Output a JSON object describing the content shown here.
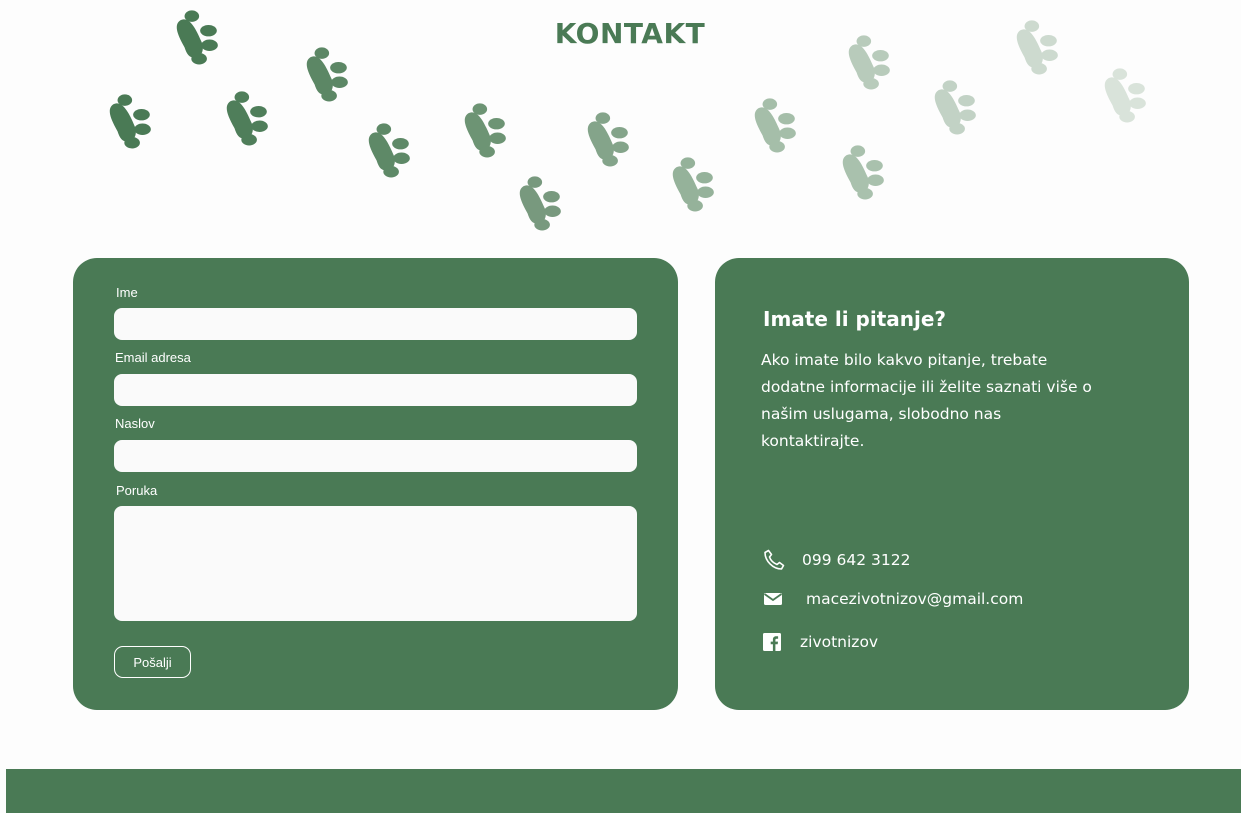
{
  "page": {
    "title": "KONTAKT"
  },
  "colors": {
    "brand_green": "#4a7a55",
    "field_background": "#fafafa",
    "page_background": "#fdfdfd"
  },
  "decoration": {
    "icon": "paw-print-icon"
  },
  "form": {
    "name_label": "Ime",
    "email_label": "Email adresa",
    "subject_label": "Naslov",
    "message_label": "Poruka",
    "name_value": "",
    "email_value": "",
    "subject_value": "",
    "message_value": "",
    "submit_label": "Pošalji"
  },
  "info": {
    "heading": "Imate li pitanje?",
    "text": "Ako imate bilo kakvo pitanje, trebate dodatne informacije ili želite saznati više o našim uslugama, slobodno nas kontaktirajte.",
    "contacts": [
      {
        "icon": "phone-icon",
        "text": "099 642 3122"
      },
      {
        "icon": "mail-icon",
        "text": "macezivotnizov@gmail.com"
      },
      {
        "icon": "facebook-icon",
        "text": "zivotnizov"
      }
    ]
  }
}
